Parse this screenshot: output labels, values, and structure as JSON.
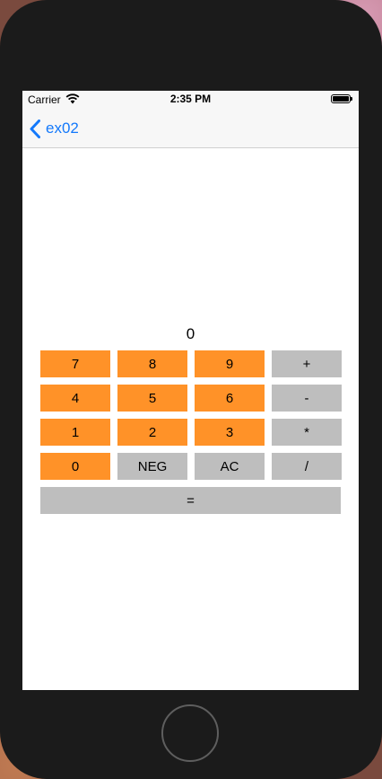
{
  "status_bar": {
    "carrier": "Carrier",
    "time": "2:35 PM"
  },
  "nav_bar": {
    "back_label": "ex02"
  },
  "calculator": {
    "display_value": "0",
    "rows": [
      [
        {
          "label": "7",
          "color": "orange"
        },
        {
          "label": "8",
          "color": "orange"
        },
        {
          "label": "9",
          "color": "orange"
        },
        {
          "label": "+",
          "color": "gray"
        }
      ],
      [
        {
          "label": "4",
          "color": "orange"
        },
        {
          "label": "5",
          "color": "orange"
        },
        {
          "label": "6",
          "color": "orange"
        },
        {
          "label": "-",
          "color": "gray"
        }
      ],
      [
        {
          "label": "1",
          "color": "orange"
        },
        {
          "label": "2",
          "color": "orange"
        },
        {
          "label": "3",
          "color": "orange"
        },
        {
          "label": "*",
          "color": "gray"
        }
      ],
      [
        {
          "label": "0",
          "color": "orange"
        },
        {
          "label": "NEG",
          "color": "gray"
        },
        {
          "label": "AC",
          "color": "gray"
        },
        {
          "label": "/",
          "color": "gray"
        }
      ]
    ],
    "equals_label": "="
  },
  "colors": {
    "accent": "#1479fb",
    "digit_key": "#ff9228",
    "operator_key": "#bebebe"
  }
}
